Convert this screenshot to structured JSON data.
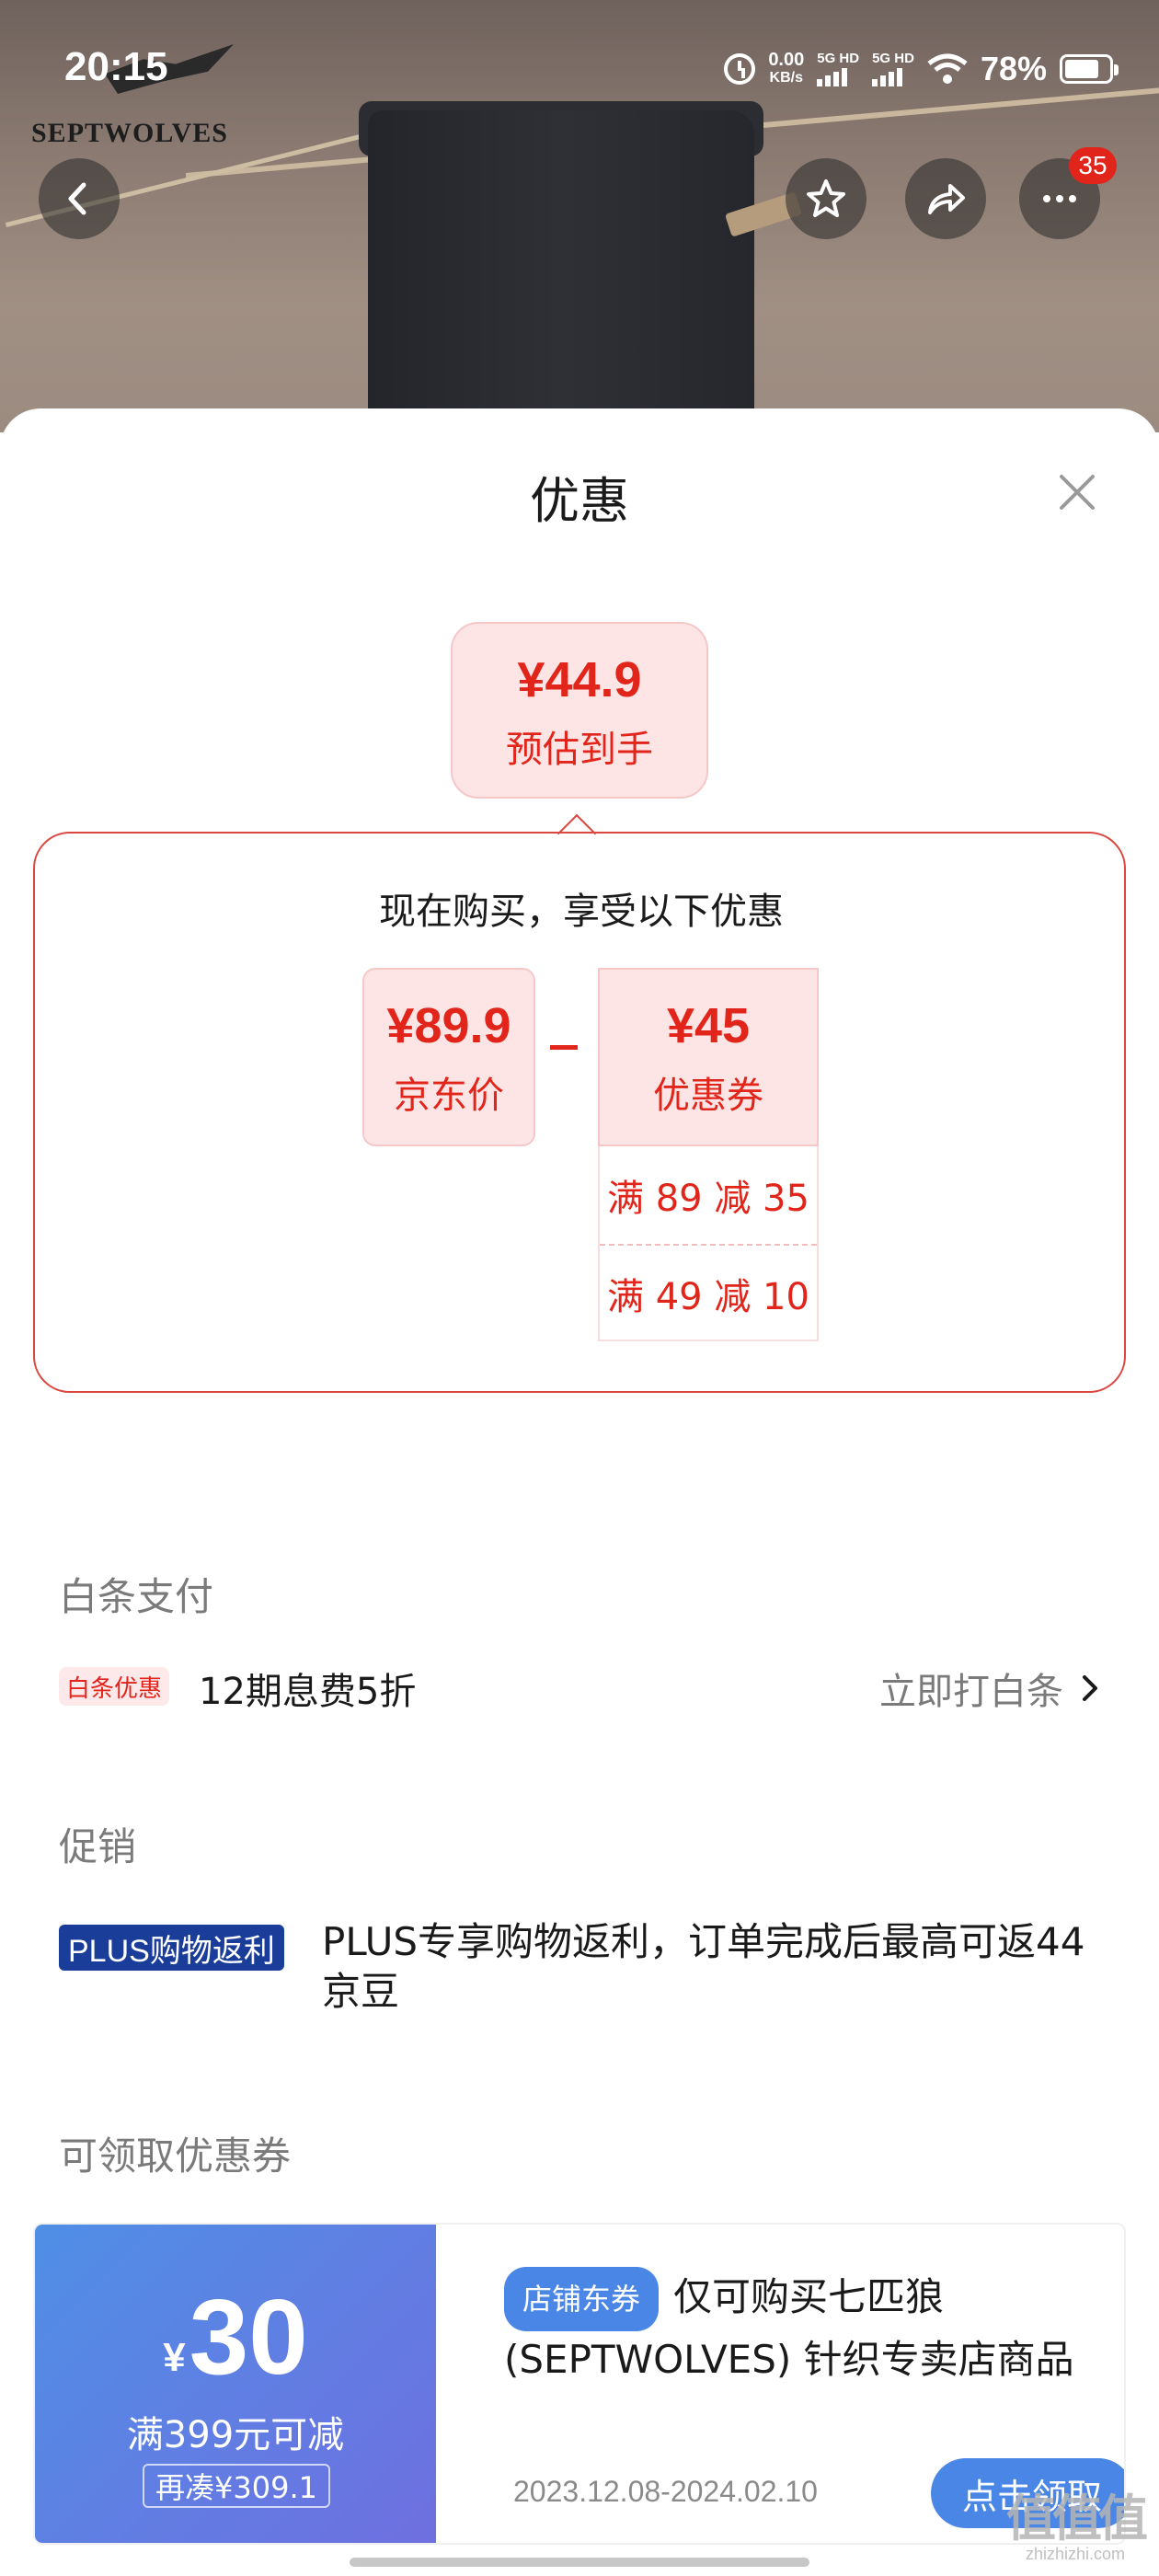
{
  "status_bar": {
    "time": "20:15",
    "net_speed": "0.00",
    "net_unit": "KB/s",
    "sim1": "5G HD",
    "sim2": "5G HD",
    "battery": "78%"
  },
  "brand_logo": "SEPTWOLVES",
  "header": {
    "more_badge": "35"
  },
  "sheet": {
    "title": "优惠",
    "estimate": {
      "price": "¥44.9",
      "label": "预估到手"
    },
    "deal": {
      "heading": "现在购买，享受以下优惠",
      "jd_price": {
        "value": "¥89.9",
        "label": "京东价"
      },
      "coupon": {
        "value": "¥45",
        "label": "优惠券"
      },
      "rules": [
        "满 89 减 35",
        "满 49 减 10"
      ]
    },
    "baitiao": {
      "section_title": "白条支付",
      "tag": "白条优惠",
      "text": "12期息费5折",
      "action": "立即打白条"
    },
    "promo": {
      "section_title": "促销",
      "tag": "PLUS购物返利",
      "text": "PLUS专享购物返利，订单完成后最高可返44京豆"
    },
    "coupons": {
      "section_title": "可领取优惠券",
      "items": [
        {
          "currency": "¥",
          "amount": "30",
          "condition": "满399元可减",
          "more": "再凑¥309.1",
          "type": "店铺东券",
          "description": "仅可购买七匹狼(SEPTWOLVES) 针织专卖店商品",
          "date_range": "2023.12.08-2024.02.10",
          "button": "点击领取"
        }
      ]
    }
  },
  "watermark": {
    "glyphs": "值值值",
    "text": "zhizhizhi.com"
  },
  "colors": {
    "accent_red": "#e1251b",
    "coupon_blue": "#4a86e6",
    "plus_blue": "#1b3d9a"
  }
}
